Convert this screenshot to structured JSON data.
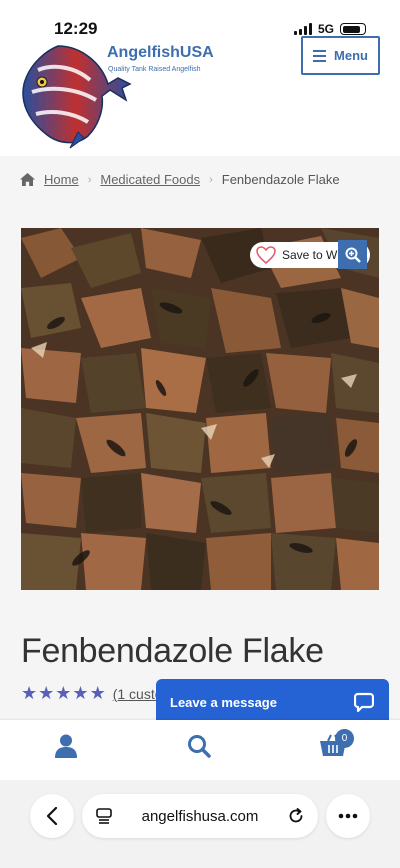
{
  "status_bar": {
    "time": "12:29",
    "network": "5G"
  },
  "header": {
    "site_name": "AngelfishUSA",
    "tagline": "Quality Tank Raised Angelfish",
    "menu_label": "Menu"
  },
  "breadcrumb": {
    "home": "Home",
    "category": "Medicated Foods",
    "current": "Fenbendazole Flake"
  },
  "product": {
    "wishlist_label": "Save to Wishlist",
    "title": "Fenbendazole Flake",
    "rating_stars": 5,
    "review_text": "(1 customer review)"
  },
  "chat": {
    "label": "Leave a message"
  },
  "footer": {
    "cart_count": "0"
  },
  "browser": {
    "url": "angelfishusa.com"
  },
  "colors": {
    "accent": "#3d6fb0",
    "chat": "#2563d4",
    "stars": "#5b5fb8"
  },
  "icons": [
    "signal-icon",
    "battery-icon",
    "hamburger-icon",
    "home-icon",
    "heart-icon",
    "zoom-icon",
    "star-icon",
    "chat-bubble-icon",
    "user-icon",
    "search-icon",
    "cart-icon",
    "back-icon",
    "reader-icon",
    "reload-icon",
    "more-icon"
  ]
}
